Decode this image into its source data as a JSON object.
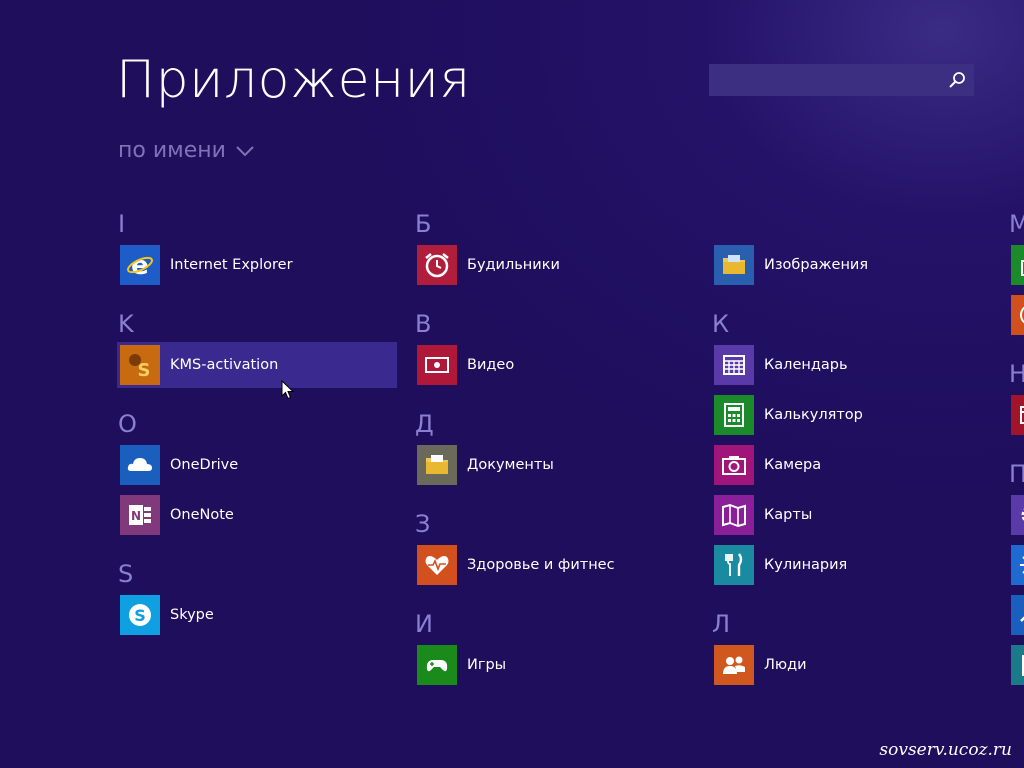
{
  "header": {
    "title": "Приложения",
    "sort_label": "по имени",
    "search_placeholder": ""
  },
  "colors": {
    "background": "#1e0e5c",
    "accent_letter": "#8a7fd0",
    "sort_text": "#7e72b8",
    "selected_bg": "#3a2a90"
  },
  "columns": [
    {
      "groups": [
        {
          "letter": "I",
          "apps": [
            {
              "label": "Internet Explorer",
              "icon": "internet-explorer-icon",
              "tile": "#1e5cc8"
            }
          ]
        },
        {
          "letter": "K",
          "apps": [
            {
              "label": "KMS-activation",
              "icon": "kms-activation-icon",
              "tile": "#c86a10",
              "selected": true
            }
          ]
        },
        {
          "letter": "O",
          "apps": [
            {
              "label": "OneDrive",
              "icon": "onedrive-icon",
              "tile": "#1a5fbd"
            },
            {
              "label": "OneNote",
              "icon": "onenote-icon",
              "tile": "#80397b"
            }
          ]
        },
        {
          "letter": "S",
          "apps": [
            {
              "label": "Skype",
              "icon": "skype-icon",
              "tile": "#0ea0e0"
            }
          ]
        }
      ]
    },
    {
      "groups": [
        {
          "letter": "Б",
          "apps": [
            {
              "label": "Будильники",
              "icon": "alarm-clock-icon",
              "tile": "#b01e3c"
            }
          ]
        },
        {
          "letter": "В",
          "apps": [
            {
              "label": "Видео",
              "icon": "video-icon",
              "tile": "#b0183a"
            }
          ]
        },
        {
          "letter": "Д",
          "apps": [
            {
              "label": "Документы",
              "icon": "documents-folder-icon",
              "tile": "#6a6a5a"
            }
          ]
        },
        {
          "letter": "З",
          "apps": [
            {
              "label": "Здоровье и фитнес",
              "icon": "health-heart-icon",
              "tile": "#d2501e"
            }
          ]
        },
        {
          "letter": "И",
          "apps": [
            {
              "label": "Игры",
              "icon": "gamepad-icon",
              "tile": "#1a8a1a"
            }
          ]
        }
      ]
    },
    {
      "groups": [
        {
          "letter": "",
          "apps": [
            {
              "label": "Изображения",
              "icon": "pictures-folder-icon",
              "tile": "#2a5fb0"
            }
          ]
        },
        {
          "letter": "К",
          "apps": [
            {
              "label": "Календарь",
              "icon": "calendar-icon",
              "tile": "#5a3aa8"
            },
            {
              "label": "Калькулятор",
              "icon": "calculator-icon",
              "tile": "#1a8a2a"
            },
            {
              "label": "Камера",
              "icon": "camera-icon",
              "tile": "#a0157a"
            },
            {
              "label": "Карты",
              "icon": "maps-icon",
              "tile": "#8a1f9a"
            },
            {
              "label": "Кулинария",
              "icon": "food-icon",
              "tile": "#1a8aa0"
            }
          ]
        },
        {
          "letter": "Л",
          "apps": [
            {
              "label": "Люди",
              "icon": "people-icon",
              "tile": "#d0581e"
            }
          ]
        }
      ]
    },
    {
      "groups": [
        {
          "letter": "М",
          "apps": [
            {
              "label": "",
              "icon": "store-icon",
              "tile": "#1a8a2a"
            },
            {
              "label": "",
              "icon": "music-icon",
              "tile": "#d0501e"
            }
          ]
        },
        {
          "letter": "Н",
          "apps": [
            {
              "label": "",
              "icon": "news-icon",
              "tile": "#a0152a"
            }
          ]
        },
        {
          "letter": "П",
          "apps": [
            {
              "label": "",
              "icon": "settings-icon",
              "tile": "#5a3aa8"
            },
            {
              "label": "",
              "icon": "weather-icon",
              "tile": "#1e6ad0"
            },
            {
              "label": "",
              "icon": "finance-icon",
              "tile": "#1a5fbd"
            },
            {
              "label": "",
              "icon": "reader-icon",
              "tile": "#1a7a8a"
            }
          ]
        }
      ]
    }
  ],
  "watermark": "sovserv.ucoz.ru"
}
